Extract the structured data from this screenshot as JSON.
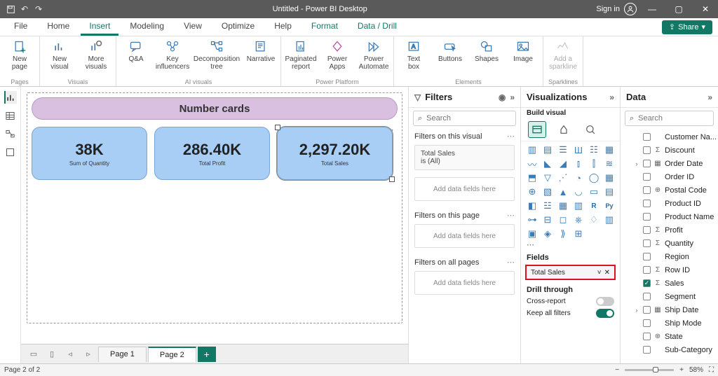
{
  "title": "Untitled - Power BI Desktop",
  "signin": "Sign in",
  "menubar": [
    "File",
    "Home",
    "Insert",
    "Modeling",
    "View",
    "Optimize",
    "Help",
    "Format",
    "Data / Drill"
  ],
  "share": "Share",
  "ribbon": {
    "pages": {
      "label": "Pages",
      "items": [
        {
          "l1": "New",
          "l2": "page"
        }
      ]
    },
    "visuals": {
      "label": "Visuals",
      "items": [
        {
          "l1": "New",
          "l2": "visual"
        },
        {
          "l1": "More",
          "l2": "visuals"
        }
      ]
    },
    "ai": {
      "label": "AI visuals",
      "items": [
        {
          "l1": "Q&A",
          "l2": ""
        },
        {
          "l1": "Key",
          "l2": "influencers"
        },
        {
          "l1": "Decomposition",
          "l2": "tree"
        },
        {
          "l1": "Narrative",
          "l2": ""
        }
      ]
    },
    "power": {
      "label": "Power Platform",
      "items": [
        {
          "l1": "Paginated",
          "l2": "report"
        },
        {
          "l1": "Power",
          "l2": "Apps"
        },
        {
          "l1": "Power",
          "l2": "Automate"
        }
      ]
    },
    "elements": {
      "label": "Elements",
      "items": [
        {
          "l1": "Text",
          "l2": "box"
        },
        {
          "l1": "Buttons",
          "l2": ""
        },
        {
          "l1": "Shapes",
          "l2": ""
        },
        {
          "l1": "Image",
          "l2": ""
        }
      ]
    },
    "spark": {
      "label": "Sparklines",
      "items": [
        {
          "l1": "Add a",
          "l2": "sparkline"
        }
      ]
    }
  },
  "canvas": {
    "title": "Number cards",
    "cards": [
      {
        "value": "38K",
        "label": "Sum of Quantity"
      },
      {
        "value": "286.40K",
        "label": "Total Profit"
      },
      {
        "value": "2,297.20K",
        "label": "Total Sales"
      }
    ]
  },
  "pages": {
    "list": [
      "Page 1",
      "Page 2"
    ],
    "status": "Page 2 of 2",
    "zoom": "58%"
  },
  "filters": {
    "title": "Filters",
    "search_placeholder": "Search",
    "visual_section": "Filters on this visual",
    "visual_name": "Total Sales",
    "visual_cond": "is (All)",
    "add_here": "Add data fields here",
    "page_section": "Filters on this page",
    "all_section": "Filters on all pages"
  },
  "viz": {
    "title": "Visualizations",
    "sub": "Build visual",
    "fields_label": "Fields",
    "field_value": "Total Sales",
    "drill_label": "Drill through",
    "cross": "Cross-report",
    "cross_off": "Off",
    "keep": "Keep all filters",
    "keep_on": "On"
  },
  "data": {
    "title": "Data",
    "search_placeholder": "Search",
    "fields": [
      {
        "name": "Customer Na...",
        "checked": false,
        "glyph": ""
      },
      {
        "name": "Discount",
        "checked": false,
        "glyph": "Σ"
      },
      {
        "name": "Order Date",
        "checked": false,
        "glyph": "▦",
        "exp": true
      },
      {
        "name": "Order ID",
        "checked": false,
        "glyph": ""
      },
      {
        "name": "Postal Code",
        "checked": false,
        "glyph": "⊕"
      },
      {
        "name": "Product ID",
        "checked": false,
        "glyph": ""
      },
      {
        "name": "Product Name",
        "checked": false,
        "glyph": ""
      },
      {
        "name": "Profit",
        "checked": false,
        "glyph": "Σ"
      },
      {
        "name": "Quantity",
        "checked": false,
        "glyph": "Σ"
      },
      {
        "name": "Region",
        "checked": false,
        "glyph": ""
      },
      {
        "name": "Row ID",
        "checked": false,
        "glyph": "Σ"
      },
      {
        "name": "Sales",
        "checked": true,
        "glyph": "Σ"
      },
      {
        "name": "Segment",
        "checked": false,
        "glyph": ""
      },
      {
        "name": "Ship Date",
        "checked": false,
        "glyph": "▦",
        "exp": true
      },
      {
        "name": "Ship Mode",
        "checked": false,
        "glyph": ""
      },
      {
        "name": "State",
        "checked": false,
        "glyph": "⊕"
      },
      {
        "name": "Sub-Category",
        "checked": false,
        "glyph": ""
      }
    ]
  }
}
